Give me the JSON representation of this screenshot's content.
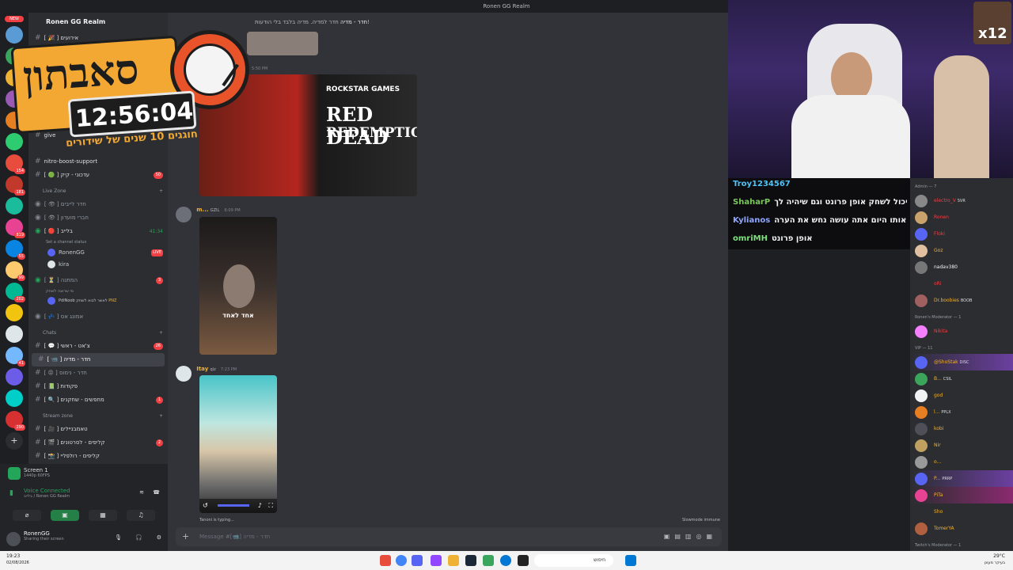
{
  "window": {
    "title": "Ronen GG Realm"
  },
  "servers": {
    "new_badge": "NEW",
    "badges": [
      "154",
      "181",
      "819",
      "55",
      "99",
      "202",
      "41",
      "290"
    ]
  },
  "sidebar": {
    "server_name": "Ronen GG Realm",
    "channels_top": [
      {
        "name": "[ 🎉 ] אירועים",
        "count": ""
      },
      {
        "name": "give",
        "count": ""
      },
      {
        "name": "nitro-boost-support",
        "count": ""
      },
      {
        "name": "[ 🟢 ] עדכוני - קיק",
        "count": "50"
      }
    ],
    "live_zone": {
      "label": "Live Zone",
      "channels": [
        {
          "name": "[ 👁 ] חדר לייבים"
        },
        {
          "name": "[ 👁 ] חברי מועדון"
        },
        {
          "name": "[ 🔴 ] בלייב",
          "time": "41:34",
          "status": "Set a channel status"
        }
      ]
    },
    "voice_users": [
      {
        "name": "RonenGG",
        "badge": "LIVE"
      },
      {
        "name": "kira"
      }
    ],
    "waiting": {
      "name": "[ ⏳ ] המתנה",
      "sub": "מי שרוצה לשחק",
      "count": "3"
    },
    "waiting_user": {
      "name": "PdiNoob",
      "text": "לאשר לבוא לשחק",
      "tag": "PNZ"
    },
    "afk": "[ 💤 ] אמונג אס",
    "chats": {
      "label": "Chats",
      "channels": [
        {
          "name": "[ 💬 ] צ'אט - ראשי",
          "count": "26"
        },
        {
          "name": "[ 📹 ] חדר - מדיה",
          "count": "",
          "selected": true
        },
        {
          "name": "[ 😡 ] חדר - נימוס",
          "count": ""
        },
        {
          "name": "[ 📗 ] פקודות",
          "count": ""
        },
        {
          "name": "[ 🔍 ] מחפשים - שחקנים",
          "count": "1"
        }
      ]
    },
    "stream_zone": {
      "label": "Stream zone",
      "channels": [
        {
          "name": "[ 🎥 ] טאמבניילים",
          "count": ""
        },
        {
          "name": "[ 🎬 ] קליפים - לסרטונים",
          "count": "2"
        },
        {
          "name": "[ 📸 ] קליפים - רולפליי",
          "count": ""
        }
      ]
    }
  },
  "voice_panel": {
    "screen_title": "Screen 1",
    "screen_sub": "1440p 60FPS",
    "connected": "Voice Connected",
    "location": "בלייב / Ronen GG Realm"
  },
  "user": {
    "name": "RonenGG",
    "status": "Sharing their screen"
  },
  "chat": {
    "header": "חדר - מדיה",
    "topic": "חדר למדיה. מדיה בלבד בלי הודעות!",
    "time1": "5:50 PM",
    "msg2_user": "m...",
    "msg2_tag": "GZIL",
    "msg2_time": "6:09 PM",
    "caption": "אחד לאחד",
    "rdr_top": "ROCKSTAR GAMES",
    "rdr_mid": "RED DEAD",
    "rdr_bot": "REDEMPTION",
    "msg3_user": "Itay",
    "msg3_tag": "qlz",
    "msg3_time": "7:23 PM",
    "typing": "Tanoni is typing...",
    "slowmode": "Slowmode immune",
    "placeholder": "Message #[📹] חדר - מדיה"
  },
  "overlay": {
    "title": "סאבתון",
    "timer": "12:56:04",
    "subtitle": "חוגגים 10 שנים של שידורים",
    "multiplier": "x12"
  },
  "stream_chat": [
    {
      "user": "Troy1234567",
      "text": "",
      "color": "#4fc3f7"
    },
    {
      "user": "ShaharP",
      "text": "אתה יכול לשחק אופן פרונט וגם שיהיה לך KPP",
      "color": "#7ac95c"
    },
    {
      "user": "Kylianos",
      "text": "זה פרצוף שאם הבנאדם הוא אותו היום אתה עושה נחש את הערה",
      "color": "#8fa6ff"
    },
    {
      "user": "omriMH",
      "text": "אופן פרונט",
      "color": "#7ae27a"
    }
  ],
  "members": {
    "admin_label": "Admin — 7",
    "admins": [
      {
        "name": "electro_V",
        "tag": "SVR"
      },
      {
        "name": "Ronen"
      },
      {
        "name": "Floki"
      },
      {
        "name": "Goz"
      },
      {
        "name": "nadav380"
      },
      {
        "name": "oRi"
      },
      {
        "name": "Dr.boobies",
        "tag": "BOOB"
      }
    ],
    "mod_label": "Ronen's Moderator — 1",
    "mods": [
      {
        "name": "Nikita"
      }
    ],
    "vip_label": "VIP — 11",
    "vips": [
      {
        "name": "@ShoStak",
        "tag": "DISC"
      },
      {
        "name": "B...",
        "tag": "CSIL"
      },
      {
        "name": "god"
      },
      {
        "name": "l...",
        "tag": "PPLX"
      },
      {
        "name": "kobi"
      },
      {
        "name": "Nir"
      },
      {
        "name": "o..."
      },
      {
        "name": "P...",
        "tag": "PRRP"
      },
      {
        "name": "PiTa"
      },
      {
        "name": "Sho"
      },
      {
        "name": "TomerYA"
      }
    ],
    "twitch_label": "Twitch's Moderator — 1"
  },
  "taskbar": {
    "time": "19:23",
    "date": "02/08/2026",
    "weather": "29°C",
    "weather_sub": "בעיקר מעונן",
    "search": "חיפוש"
  }
}
